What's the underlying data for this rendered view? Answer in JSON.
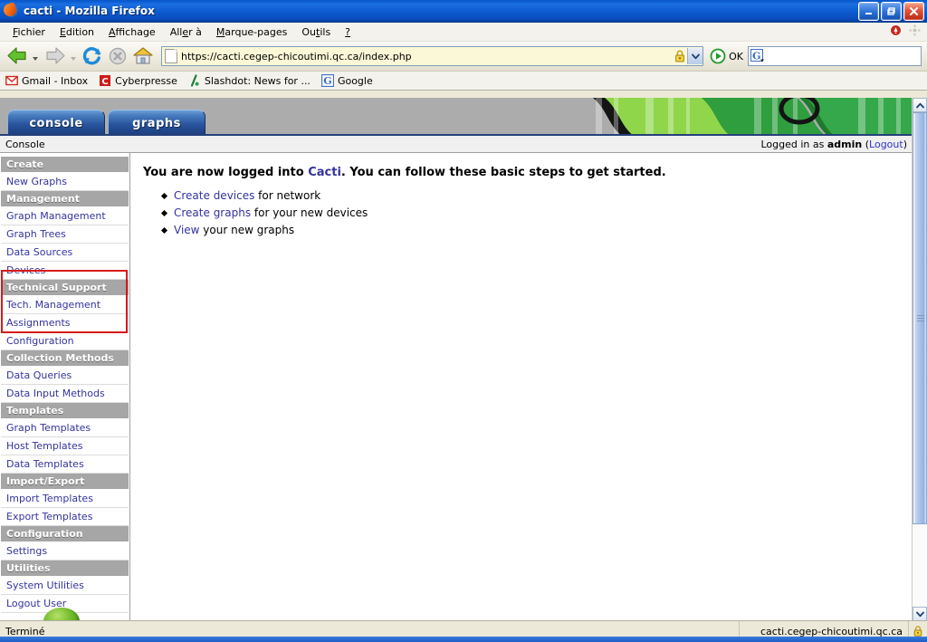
{
  "window": {
    "title": "cacti - Mozilla Firefox",
    "app_icon": "firefox-icon",
    "minimize_label": "_",
    "maximize_label": "❐",
    "close_label": "✕"
  },
  "menubar": {
    "items": [
      {
        "label": "Fichier",
        "accel": "F"
      },
      {
        "label": "Edition",
        "accel": "E"
      },
      {
        "label": "Affichage",
        "accel": "A"
      },
      {
        "label": "Aller à",
        "accel": "A"
      },
      {
        "label": "Marque-pages",
        "accel": "M"
      },
      {
        "label": "Outils",
        "accel": "t"
      },
      {
        "label": "?",
        "accel": "?"
      }
    ],
    "right_icons": [
      "popup-blocked-icon",
      "extension-icon"
    ]
  },
  "navbar": {
    "back_label": "Back",
    "forward_label": "Forward",
    "reload_label": "Reload",
    "stop_label": "Stop",
    "home_label": "Home",
    "url_value": "https://cacti.cegep-chicoutimi.qc.ca/index.php",
    "url_placeholder": "",
    "lock_icon": "padlock-icon",
    "dropdown_icon": "chevron-down-icon",
    "go_icon": "go-icon",
    "go_label": "OK",
    "search_value": "",
    "search_placeholder": "",
    "search_engine_icon": "google-icon"
  },
  "bookmarks": [
    {
      "label": "Gmail - Inbox",
      "icon": "gmail-icon"
    },
    {
      "label": "Cyberpresse",
      "icon": "cyberpresse-icon"
    },
    {
      "label": "Slashdot: News for ...",
      "icon": "slashdot-icon"
    },
    {
      "label": "Google",
      "icon": "google-icon"
    }
  ],
  "cacti": {
    "tabs": [
      {
        "label": "console",
        "active": true
      },
      {
        "label": "graphs",
        "active": false
      }
    ],
    "banner_icon": "cactus-banner",
    "subbar": {
      "breadcrumb": "Console",
      "logged_in_prefix": "Logged in as",
      "username": "admin",
      "logout_open": "(",
      "logout_label": "Logout",
      "logout_close": ")"
    },
    "sidebar": [
      {
        "type": "head",
        "label": "Create"
      },
      {
        "type": "link",
        "label": "New Graphs"
      },
      {
        "type": "head",
        "label": "Management"
      },
      {
        "type": "link",
        "label": "Graph Management"
      },
      {
        "type": "link",
        "label": "Graph Trees"
      },
      {
        "type": "link",
        "label": "Data Sources"
      },
      {
        "type": "link",
        "label": "Devices"
      },
      {
        "type": "head",
        "label": "Technical Support"
      },
      {
        "type": "link",
        "label": "Tech. Management"
      },
      {
        "type": "link",
        "label": "Assignments"
      },
      {
        "type": "link",
        "label": "Configuration"
      },
      {
        "type": "head",
        "label": "Collection Methods"
      },
      {
        "type": "link",
        "label": "Data Queries"
      },
      {
        "type": "link",
        "label": "Data Input Methods"
      },
      {
        "type": "head",
        "label": "Templates"
      },
      {
        "type": "link",
        "label": "Graph Templates"
      },
      {
        "type": "link",
        "label": "Host Templates"
      },
      {
        "type": "link",
        "label": "Data Templates"
      },
      {
        "type": "head",
        "label": "Import/Export"
      },
      {
        "type": "link",
        "label": "Import Templates"
      },
      {
        "type": "link",
        "label": "Export Templates"
      },
      {
        "type": "head",
        "label": "Configuration"
      },
      {
        "type": "link",
        "label": "Settings"
      },
      {
        "type": "head",
        "label": "Utilities"
      },
      {
        "type": "link",
        "label": "System Utilities"
      },
      {
        "type": "link",
        "label": "Logout User"
      }
    ],
    "highlight_color": "#d81a1a",
    "content": {
      "heading_part1": "You are now logged into ",
      "heading_link": "Cacti",
      "heading_part2": ". You can follow these basic steps to get started.",
      "steps": [
        {
          "link": "Create devices",
          "rest": " for network"
        },
        {
          "link": "Create graphs",
          "rest": " for your new devices"
        },
        {
          "link": "View",
          "rest": " your new graphs"
        }
      ]
    }
  },
  "statusbar": {
    "status_text": "Terminé",
    "zone_text": "cacti.cegep-chicoutimi.qc.ca",
    "lock_icon": "padlock-icon"
  },
  "colors": {
    "title_blue": "#0b5ed4",
    "cacti_link": "#33339e",
    "menu_head_gray": "#a6a6a6",
    "highlight_red": "#d81a1a"
  }
}
